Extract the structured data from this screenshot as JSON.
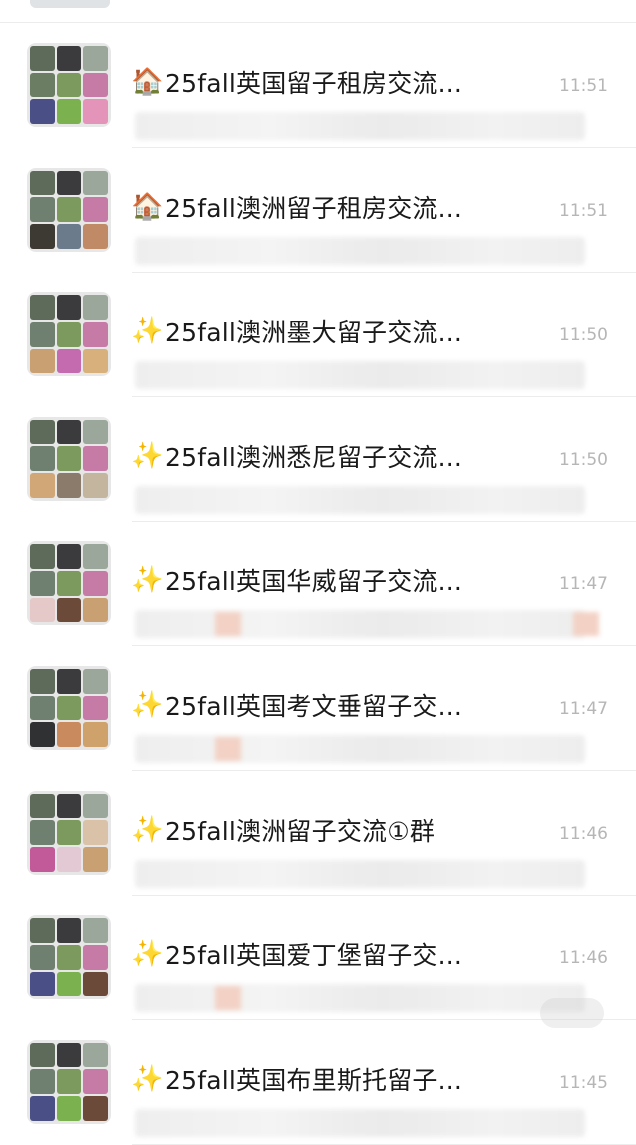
{
  "chats": [
    {
      "icon": "house-icon",
      "icon_glyph": "🏠",
      "title": "25fall英国留子租房交流...",
      "time": "11:51"
    },
    {
      "icon": "house-icon",
      "icon_glyph": "🏠",
      "title": "25fall澳洲留子租房交流...",
      "time": "11:51"
    },
    {
      "icon": "sparkles-icon",
      "icon_glyph": "✨",
      "title": "25fall澳洲墨大留子交流...",
      "time": "11:50"
    },
    {
      "icon": "sparkles-icon",
      "icon_glyph": "✨",
      "title": "25fall澳洲悉尼留子交流...",
      "time": "11:50"
    },
    {
      "icon": "sparkles-icon",
      "icon_glyph": "✨",
      "title": "25fall英国华威留子交流...",
      "time": "11:47"
    },
    {
      "icon": "sparkles-icon",
      "icon_glyph": "✨",
      "title": "25fall英国考文垂留子交...",
      "time": "11:47"
    },
    {
      "icon": "sparkles-icon",
      "icon_glyph": "✨",
      "title": "25fall澳洲留子交流①群",
      "time": "11:46"
    },
    {
      "icon": "sparkles-icon",
      "icon_glyph": "✨",
      "title": "25fall英国爱丁堡留子交...",
      "time": "11:46"
    },
    {
      "icon": "sparkles-icon",
      "icon_glyph": "✨",
      "title": "25fall英国布里斯托留子...",
      "time": "11:45"
    }
  ],
  "colors": {
    "title": "#1a1a1a",
    "time": "#b6b6b6",
    "divider": "#ececec",
    "house_icon": "#c96f2b",
    "sparkle_icon": "#f3c437"
  }
}
